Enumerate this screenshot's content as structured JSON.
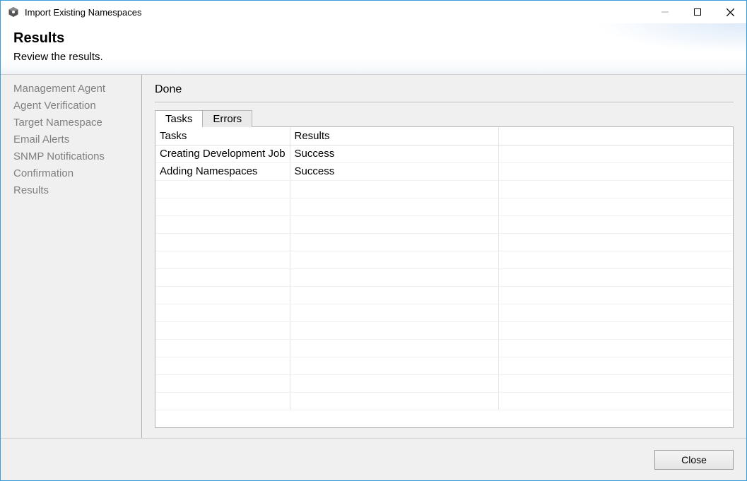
{
  "window": {
    "title": "Import Existing Namespaces"
  },
  "header": {
    "title": "Results",
    "subtitle": "Review the results."
  },
  "sidebar": {
    "items": [
      {
        "label": "Management Agent"
      },
      {
        "label": "Agent Verification"
      },
      {
        "label": "Target Namespace"
      },
      {
        "label": "Email Alerts"
      },
      {
        "label": "SNMP Notifications"
      },
      {
        "label": "Confirmation"
      },
      {
        "label": "Results"
      }
    ]
  },
  "main": {
    "status": "Done",
    "tabs": [
      {
        "label": "Tasks",
        "active": true
      },
      {
        "label": "Errors",
        "active": false
      }
    ],
    "task_table": {
      "columns": [
        "Tasks",
        "Results",
        ""
      ],
      "rows": [
        {
          "task": "Creating Development Job",
          "result": "Success"
        },
        {
          "task": "Adding Namespaces",
          "result": "Success"
        }
      ],
      "empty_row_count": 13
    }
  },
  "footer": {
    "close_label": "Close"
  }
}
